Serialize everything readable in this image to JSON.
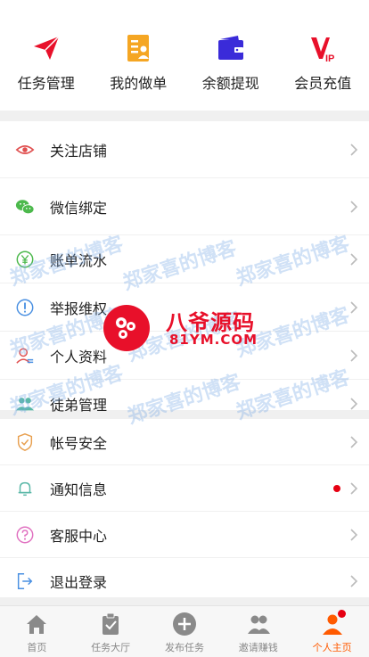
{
  "quick_actions": [
    {
      "label": "任务管理",
      "icon": "paper-plane-icon",
      "color": "#e8102a"
    },
    {
      "label": "我的做单",
      "icon": "order-doc-icon",
      "color": "#f5a623"
    },
    {
      "label": "余额提现",
      "icon": "wallet-icon",
      "color": "#3a2bd9"
    },
    {
      "label": "会员充值",
      "icon": "vip-icon",
      "color": "#e8102a"
    }
  ],
  "menu_group_1": [
    {
      "label": "关注店铺",
      "icon": "eye-icon"
    },
    {
      "label": "微信绑定",
      "icon": "wechat-icon"
    },
    {
      "label": "账单流水",
      "icon": "yen-icon"
    },
    {
      "label": "举报维权",
      "icon": "info-icon"
    },
    {
      "label": "个人资料",
      "icon": "profile-icon"
    },
    {
      "label": "徒弟管理",
      "icon": "users-icon"
    }
  ],
  "menu_group_2": [
    {
      "label": "帐号安全",
      "icon": "shield-icon"
    },
    {
      "label": "通知信息",
      "icon": "bell-icon"
    },
    {
      "label": "客服中心",
      "icon": "help-icon"
    },
    {
      "label": "退出登录",
      "icon": "logout-icon"
    }
  ],
  "tabs": [
    {
      "label": "首页",
      "icon": "home-icon"
    },
    {
      "label": "任务大厅",
      "icon": "clipboard-icon"
    },
    {
      "label": "发布任务",
      "icon": "plus-circle-icon"
    },
    {
      "label": "邀请赚钱",
      "icon": "invite-users-icon"
    },
    {
      "label": "个人主页",
      "icon": "person-icon",
      "active": true
    }
  ],
  "watermark": "郑家喜的博客",
  "logo": {
    "main": "八爷源码",
    "sub": "81YM.COM"
  },
  "colors": {
    "accent": "#ff5a00",
    "badge": "#e60012",
    "text": "#222222"
  }
}
